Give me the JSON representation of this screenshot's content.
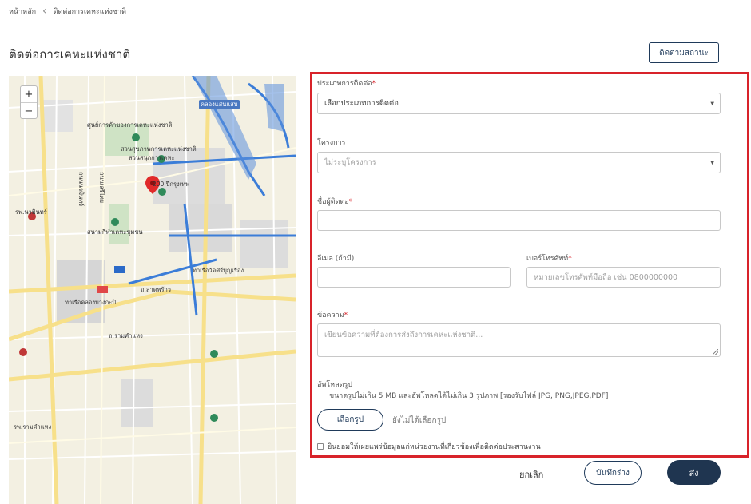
{
  "breadcrumb": {
    "home": "หน้าหลัก",
    "current": "ติดต่อการเคหะแห่งชาติ"
  },
  "page_title": "ติดต่อการเคหะแห่งชาติ",
  "track_button": "ติดตามสถานะ",
  "map": {
    "zoom_in": "+",
    "zoom_out": "−",
    "labels": {
      "nha_office": "ศูนย์การค้าของการเคหะแห่งชาติ",
      "nha_park": "สวนสุขภาพการเคหะแห่งชาติ",
      "bank": "200 ปีกรุงเทพ",
      "hospital": "รพ.นวมินทร์",
      "lat_phrao": "ถ.ลาดพร้าว",
      "ram_inthra": "ถ.รามคำแหง",
      "park2": "สนามกีฬาเคหะชุมชน",
      "mall": "ท่าเรือคลองบางกะปิ",
      "school": "สวนสนุกการเคหะ",
      "road_v1": "ถนนนวมินทร์",
      "road_v2": "ถนนเสรีไทย",
      "canal": "คลองแสนแสบ",
      "pier": "ท่าเรือวัดศรีบุญเรือง",
      "clinic": "รพ.รามคำแหง"
    }
  },
  "form": {
    "contact_type_label": "ประเภทการติดต่อ",
    "contact_type_value": "เลือกประเภทการติดต่อ",
    "project_label": "โครงการ",
    "project_value": "ไม่ระบุโครงการ",
    "name_label": "ชื่อผู้ติดต่อ",
    "name_value": "",
    "email_label": "อีเมล (ถ้ามี)",
    "email_value": "",
    "phone_label": "เบอร์โทรศัพท์",
    "phone_placeholder": "หมายเลขโทรศัพท์มือถือ เช่น 0800000000",
    "message_label": "ข้อความ",
    "message_placeholder": "เขียนข้อความที่ต้องการส่งถึงการเคหะแห่งชาติ...",
    "upload_label": "อัพโหลดรูป",
    "upload_hint": "ขนาดรูปไม่เกิน 5 MB และอัพโหลดได้ไม่เกิน 3 รูปภาพ [รองรับไฟล์ JPG, PNG,JPEG,PDF]",
    "choose_button": "เลือกรูป",
    "no_file_text": "ยังไม่ได้เลือกรูป",
    "consent_text": "ยินยอมให้เผยแพร่ข้อมูลแก่หน่วยงานที่เกี่ยวข้องเพื่อติดต่อประสานงาน",
    "required_mark": "*",
    "select_arrow": "▼"
  },
  "actions": {
    "cancel": "ยกเลิก",
    "save_draft": "บันทึกร่าง",
    "send": "ส่ง"
  },
  "colors": {
    "highlight": "#d8232a",
    "primary": "#1f3550",
    "map_bg": "#f3f0e2",
    "water": "#3b7dd8"
  }
}
